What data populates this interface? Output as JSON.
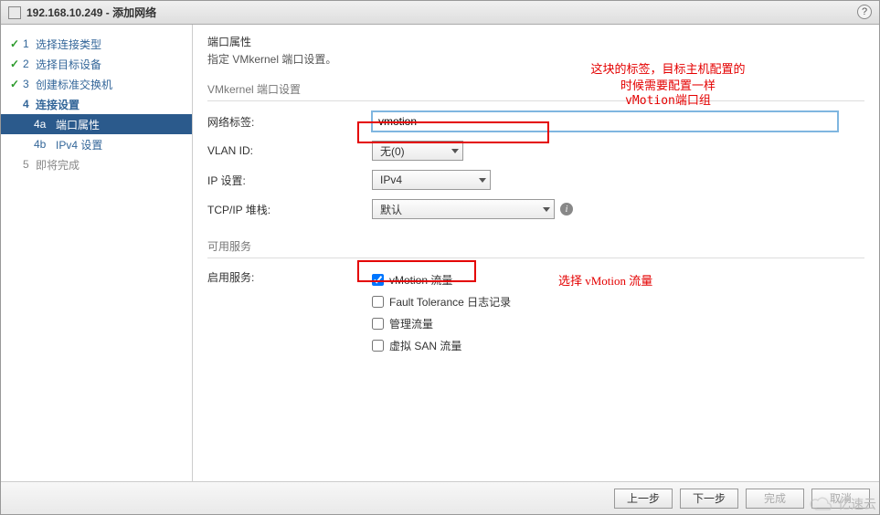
{
  "window": {
    "title": "192.168.10.249 - 添加网络",
    "help_char": "?"
  },
  "sidebar": {
    "steps": [
      {
        "num": "1",
        "label": "选择连接类型",
        "state": "done"
      },
      {
        "num": "2",
        "label": "选择目标设备",
        "state": "done"
      },
      {
        "num": "3",
        "label": "创建标准交换机",
        "state": "done"
      },
      {
        "num": "4",
        "label": "连接设置",
        "state": "current"
      },
      {
        "num": "5",
        "label": "即将完成",
        "state": "pending"
      }
    ],
    "substeps": [
      {
        "num": "4a",
        "label": "端口属性",
        "active": true
      },
      {
        "num": "4b",
        "label": "IPv4 设置",
        "active": false
      }
    ]
  },
  "main": {
    "heading": "端口属性",
    "subheading": "指定 VMkernel 端口设置。",
    "group1": "VMkernel 端口设置",
    "fields": {
      "network_label": {
        "label": "网络标签:",
        "value": "vmotion"
      },
      "vlan_id": {
        "label": "VLAN ID:",
        "value": "无(0)"
      },
      "ip_settings": {
        "label": "IP 设置:",
        "value": "IPv4"
      },
      "tcpip_stack": {
        "label": "TCP/IP 堆栈:",
        "value": "默认"
      }
    },
    "group2": "可用服务",
    "services_label": "启用服务:",
    "services": [
      {
        "label": "vMotion 流量",
        "checked": true
      },
      {
        "label": "Fault Tolerance 日志记录",
        "checked": false
      },
      {
        "label": "管理流量",
        "checked": false
      },
      {
        "label": "虚拟 SAN 流量",
        "checked": false
      }
    ]
  },
  "annotations": {
    "top1": "这块的标签，目标主机配置的",
    "top2": "时候需要配置一样",
    "top3": "vMotion端口组",
    "mid": "选择 vMotion 流量"
  },
  "footer": {
    "prev": "上一步",
    "next": "下一步",
    "finish": "完成",
    "cancel": "取消"
  },
  "watermark": "亿速云"
}
